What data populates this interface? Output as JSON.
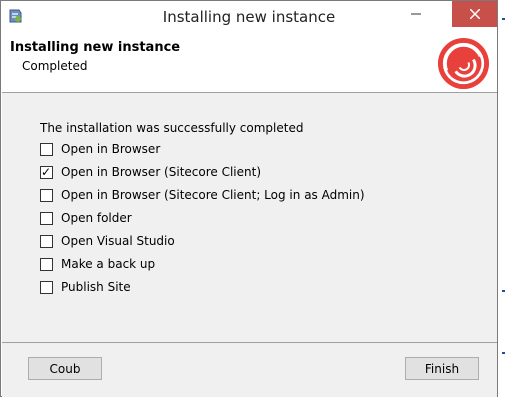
{
  "window": {
    "title": "Installing new instance",
    "close_color": "#c7504a"
  },
  "header": {
    "title": "Installing new instance",
    "subtitle": "Completed",
    "logo_icon": "sitecore-logo-icon",
    "logo_color": "#e8413c"
  },
  "content": {
    "message": "The installation was successfully completed",
    "options": [
      {
        "label": "Open in Browser",
        "checked": false
      },
      {
        "label": "Open in Browser (Sitecore Client)",
        "checked": true
      },
      {
        "label": "Open in Browser (Sitecore Client; Log in as Admin)",
        "checked": false
      },
      {
        "label": "Open folder",
        "checked": false
      },
      {
        "label": "Open Visual Studio",
        "checked": false
      },
      {
        "label": "Make a back up",
        "checked": false
      },
      {
        "label": "Publish Site",
        "checked": false
      }
    ]
  },
  "footer": {
    "back_label": "Coub",
    "finish_label": "Finish"
  }
}
